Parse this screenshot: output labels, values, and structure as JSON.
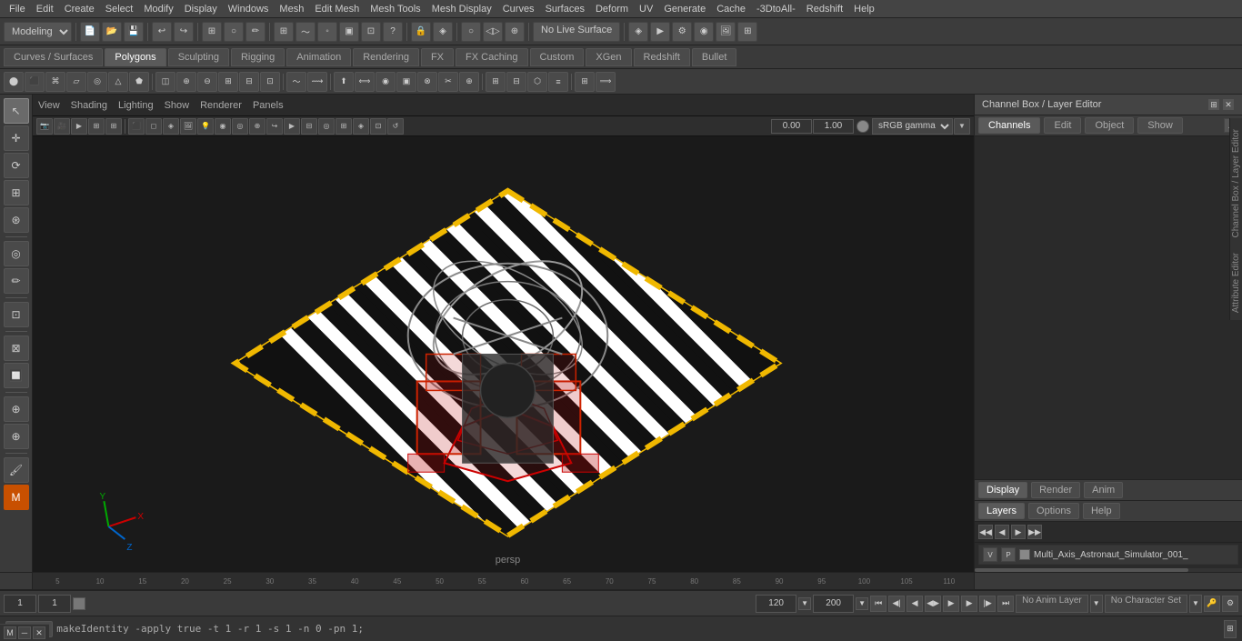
{
  "menubar": {
    "items": [
      "File",
      "Edit",
      "Create",
      "Select",
      "Modify",
      "Display",
      "Windows",
      "Mesh",
      "Edit Mesh",
      "Mesh Tools",
      "Mesh Display",
      "Curves",
      "Surfaces",
      "Deform",
      "UV",
      "Generate",
      "Cache",
      "-3DtoAll-",
      "Redshift",
      "Help"
    ]
  },
  "toolbar": {
    "mode_dropdown": "Modeling",
    "live_surface": "No Live Surface",
    "gamma_dropdown": "sRGB gamma",
    "gamma_value": "0.00",
    "exposure_value": "1.00"
  },
  "mode_tabs": {
    "tabs": [
      "Curves / Surfaces",
      "Polygons",
      "Sculpting",
      "Rigging",
      "Animation",
      "Rendering",
      "FX",
      "FX Caching",
      "Custom",
      "XGen",
      "Redshift",
      "Bullet"
    ],
    "active": "Polygons"
  },
  "viewport": {
    "menu_items": [
      "View",
      "Shading",
      "Lighting",
      "Show",
      "Renderer",
      "Panels"
    ],
    "camera_label": "persp"
  },
  "channel_box": {
    "title": "Channel Box / Layer Editor",
    "tabs": [
      "Channels",
      "Edit",
      "Object",
      "Show"
    ],
    "display_tabs": [
      "Display",
      "Render",
      "Anim"
    ],
    "active_display_tab": "Display",
    "layer_editor_tabs": [
      "Layers",
      "Options",
      "Help"
    ],
    "active_layer_tab": "Layers",
    "layer_row": {
      "vis_label": "V",
      "ref_label": "P",
      "name": "Multi_Axis_Astronaut_Simulator_001_"
    }
  },
  "timeline": {
    "ticks": [
      "5",
      "10",
      "15",
      "20",
      "25",
      "30",
      "35",
      "40",
      "45",
      "50",
      "55",
      "60",
      "65",
      "70",
      "75",
      "80",
      "85",
      "90",
      "95",
      "100",
      "105",
      "110"
    ],
    "current_frame": "1",
    "range_start": "1",
    "range_end": "120",
    "anim_end": "120",
    "max_frame": "200"
  },
  "playback": {
    "frame_field": "1",
    "anim_layer": "No Anim Layer",
    "char_set": "No Character Set"
  },
  "status_bar": {
    "tab": "Python",
    "command": "makeIdentity -apply true -t 1 -r 1 -s 1 -n 0 -pn 1;"
  },
  "right_vert_tabs": {
    "channel_box": "Channel Box / Layer Editor",
    "attribute_editor": "Attribute Editor"
  },
  "left_tools": {
    "tools": [
      "↖",
      "↕",
      "⟳",
      "⊞",
      "◎",
      "✏",
      "⊡",
      "⊠",
      "🔲",
      "⊕",
      "⊕"
    ]
  }
}
